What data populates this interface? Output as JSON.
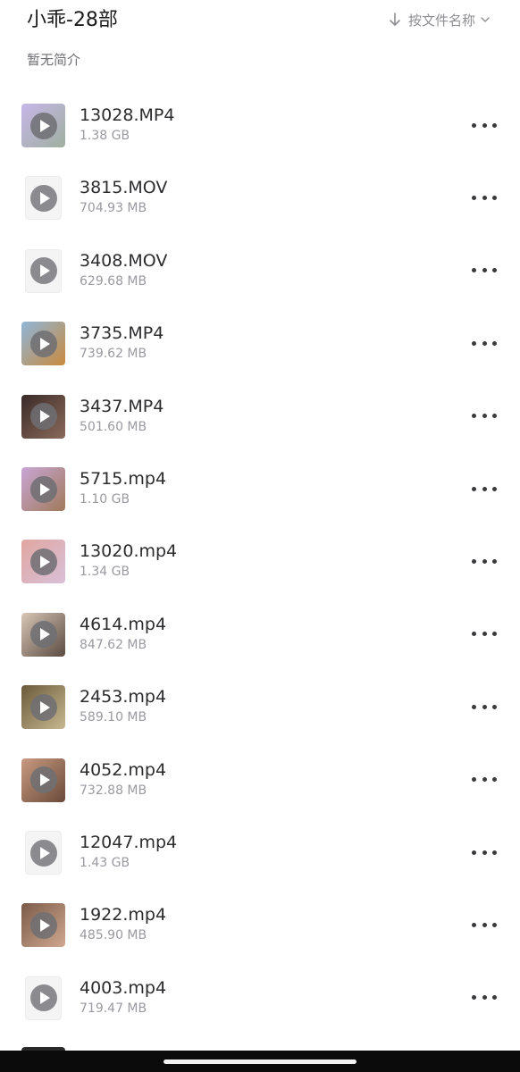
{
  "header": {
    "title": "小乖-28部",
    "subtitle": "暂无简介",
    "sort_label": "按文件名称",
    "sort_icon": "arrow-down-icon",
    "sort_chevron": "chevron-down-icon"
  },
  "files": [
    {
      "name": "13028.MP4",
      "size": "1.38 GB",
      "thumb": "video-thumbnail",
      "thumb_colors": [
        "#c7b6e8",
        "#9fb0a0"
      ]
    },
    {
      "name": "3815.MOV",
      "size": "704.93 MB",
      "thumb": "file-video-icon",
      "thumb_colors": []
    },
    {
      "name": "3408.MOV",
      "size": "629.68 MB",
      "thumb": "file-video-icon",
      "thumb_colors": []
    },
    {
      "name": "3735.MP4",
      "size": "739.62 MB",
      "thumb": "video-thumbnail",
      "thumb_colors": [
        "#8fb6d8",
        "#c98a3e"
      ]
    },
    {
      "name": "3437.MP4",
      "size": "501.60 MB",
      "thumb": "video-thumbnail",
      "thumb_colors": [
        "#3a2a28",
        "#8a6a5a"
      ]
    },
    {
      "name": "5715.mp4",
      "size": "1.10 GB",
      "thumb": "video-thumbnail",
      "thumb_colors": [
        "#c9a6d6",
        "#a07a5a"
      ]
    },
    {
      "name": "13020.mp4",
      "size": "1.34 GB",
      "thumb": "video-thumbnail",
      "thumb_colors": [
        "#e0a6a0",
        "#d9c0d8"
      ]
    },
    {
      "name": "4614.mp4",
      "size": "847.62 MB",
      "thumb": "video-thumbnail",
      "thumb_colors": [
        "#d8c6b6",
        "#5a4a40"
      ]
    },
    {
      "name": "2453.mp4",
      "size": "589.10 MB",
      "thumb": "video-thumbnail",
      "thumb_colors": [
        "#6a5a3a",
        "#c8b890"
      ]
    },
    {
      "name": "4052.mp4",
      "size": "732.88 MB",
      "thumb": "video-thumbnail",
      "thumb_colors": [
        "#c89a80",
        "#6a4a3a"
      ]
    },
    {
      "name": "12047.mp4",
      "size": "1.43 GB",
      "thumb": "file-video-icon",
      "thumb_colors": []
    },
    {
      "name": "1922.mp4",
      "size": "485.90 MB",
      "thumb": "video-thumbnail",
      "thumb_colors": [
        "#7a5a48",
        "#d0a890"
      ]
    },
    {
      "name": "4003.mp4",
      "size": "719.47 MB",
      "thumb": "file-video-icon",
      "thumb_colors": []
    }
  ],
  "more_icon": "more-horizontal-icon",
  "play_icon": "play-icon",
  "colors": {
    "title": "#1a1a1a",
    "secondary_text": "#9a9aa0",
    "sort_text": "#8e8e93",
    "background": "#ffffff"
  }
}
